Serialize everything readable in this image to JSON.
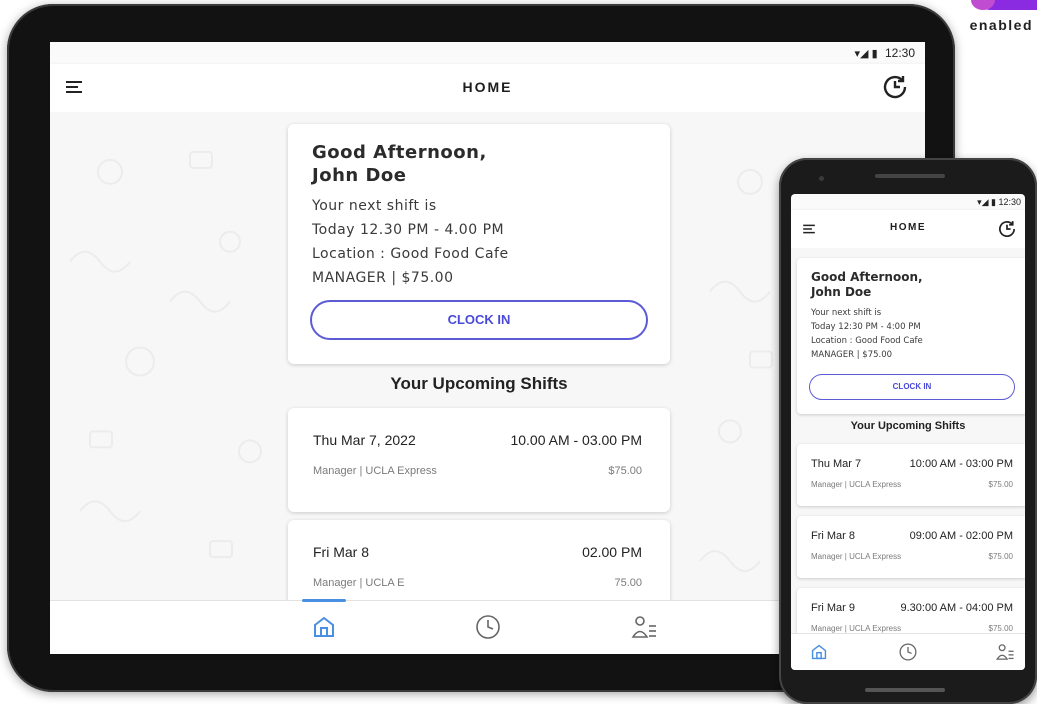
{
  "brand": {
    "logo_text": "enabled",
    "accent": "#8a2be2"
  },
  "tablet": {
    "status_time": "12:30",
    "appbar": {
      "title": "HOME",
      "menu_icon": "menu-icon",
      "history_icon": "history-icon"
    },
    "greeting": {
      "title_line1": "Good Afternoon,",
      "title_line2": "John Doe",
      "next_shift_label": "Your next shift is",
      "next_shift_time": "Today 12.30 PM - 4.00 PM",
      "location": "Location : Good Food Cafe",
      "role_pay": "MANAGER | $75.00",
      "clock_in_label": "CLOCK IN"
    },
    "upcoming_title": "Your Upcoming Shifts",
    "shifts": [
      {
        "date": "Thu Mar 7, 2022",
        "time": "10.00 AM - 03.00 PM",
        "role": "Manager | UCLA Express",
        "pay": "$75.00"
      },
      {
        "date": "Fri Mar 8",
        "time": "02.00 PM",
        "role": "Manager | UCLA E",
        "pay": "75.00"
      }
    ],
    "nav": {
      "active": "home",
      "items": [
        "home-icon",
        "timesheet-icon",
        "profile-icon"
      ]
    }
  },
  "phone": {
    "status_time": "12:30",
    "appbar": {
      "title": "HOME"
    },
    "greeting": {
      "title_line1": "Good Afternoon,",
      "title_line2": "John Doe",
      "next_shift_label": "Your next shift is",
      "next_shift_time": "Today 12:30 PM - 4:00 PM",
      "location": "Location : Good Food Cafe",
      "role_pay": "MANAGER | $75.00",
      "clock_in_label": "CLOCK IN"
    },
    "upcoming_title": "Your Upcoming Shifts",
    "shifts": [
      {
        "date": "Thu Mar 7",
        "time": "10:00 AM - 03:00 PM",
        "role": "Manager | UCLA Express",
        "pay": "$75.00"
      },
      {
        "date": "Fri Mar 8",
        "time": "09:00 AM - 02:00 PM",
        "role": "Manager | UCLA Express",
        "pay": "$75.00"
      },
      {
        "date": "Fri Mar 9",
        "time": "9.30:00 AM - 04:00 PM",
        "role": "Manager | UCLA Express",
        "pay": "$75.00"
      }
    ]
  },
  "colors": {
    "button_border": "#5b5bd6",
    "nav_active": "#4a90e2",
    "muted_text": "#7b7b7b"
  }
}
